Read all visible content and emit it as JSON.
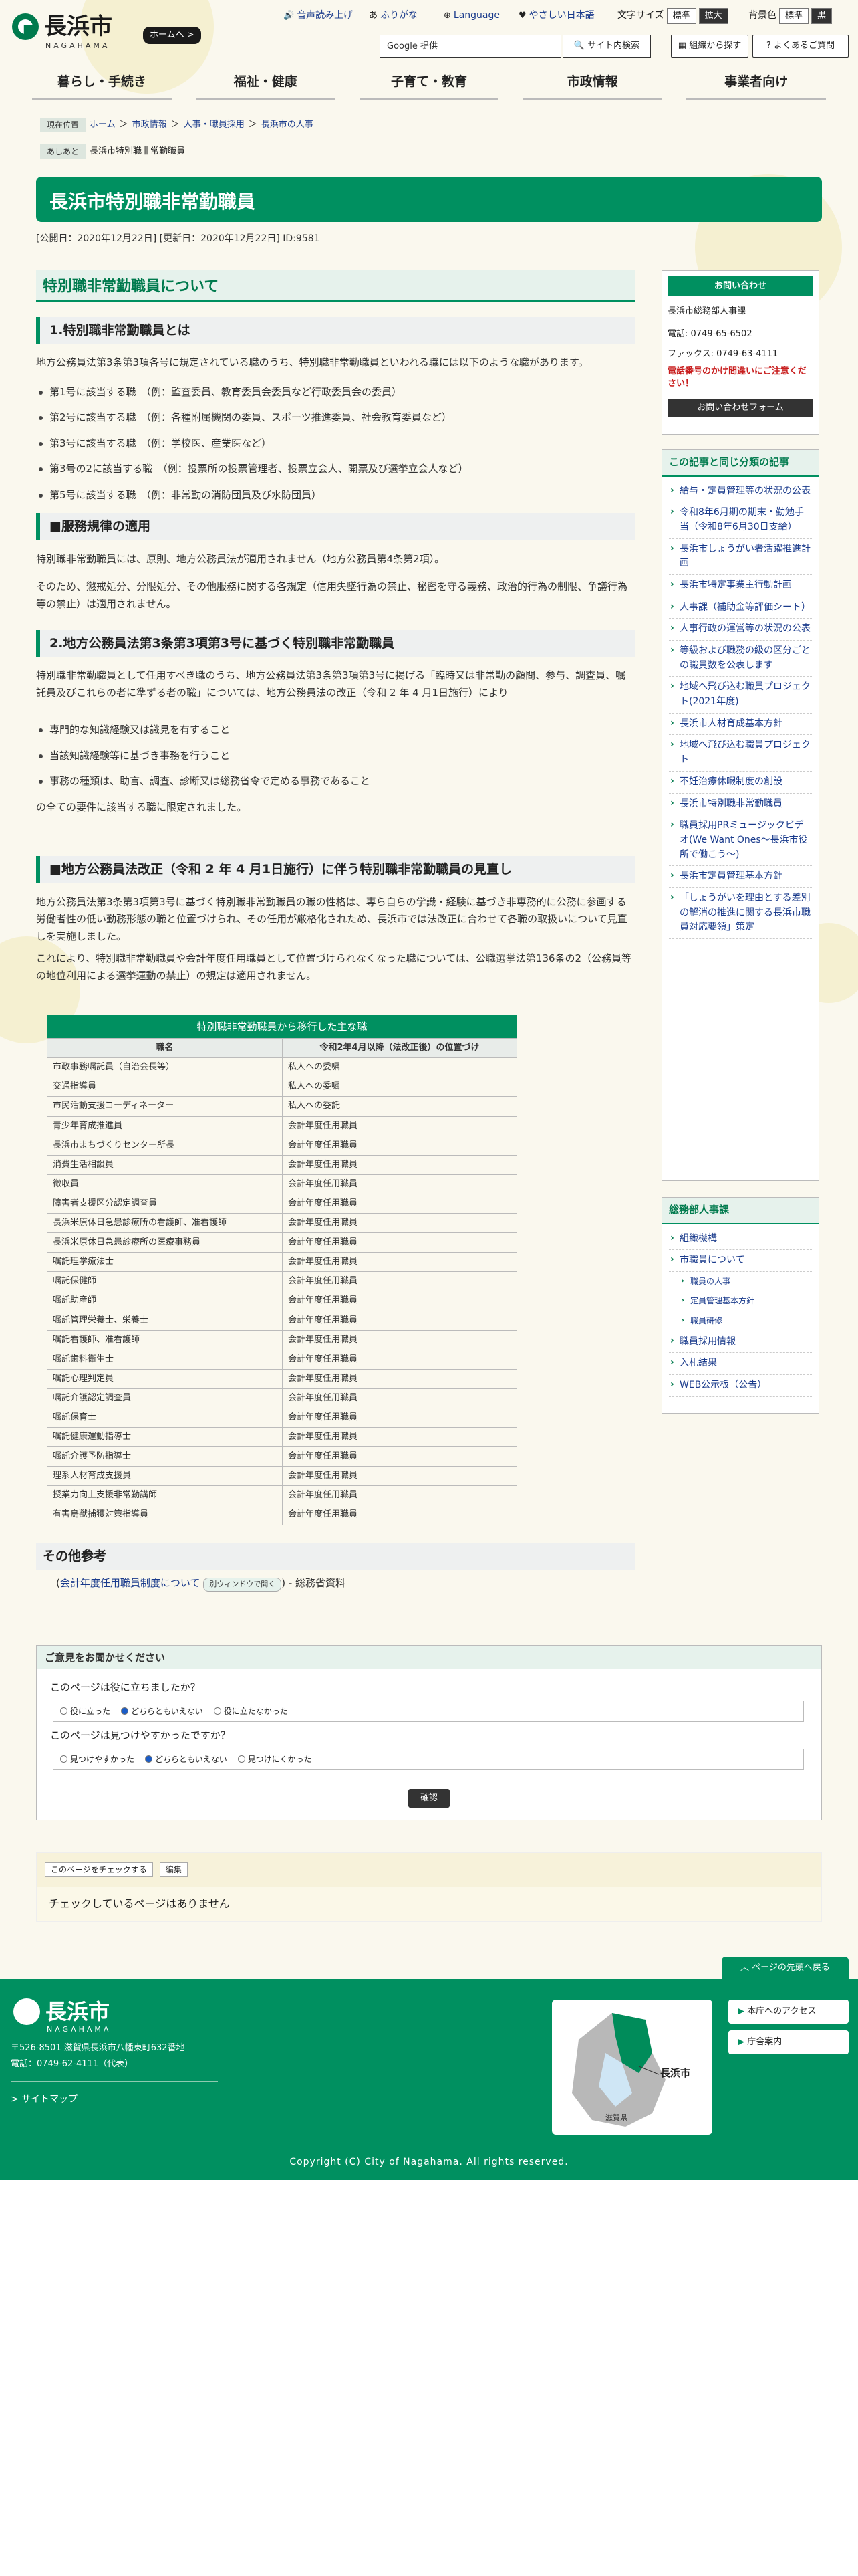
{
  "header": {
    "logo_text": "長浜市",
    "logo_sub": "NAGAHAMA",
    "home_button": "ホームへ >",
    "voice": "音声読み上げ",
    "furigana": "ふりがな",
    "language": "Language",
    "easy_japanese": "やさしい日本語",
    "font_size_label": "文字サイズ",
    "font_standard": "標準",
    "font_large": "拡大",
    "bg_color_label": "背景色",
    "bg_standard": "標準",
    "bg_black": "黒",
    "search_placeholder": "Google 提供",
    "search_button": "サイト内検索",
    "org_button": "組織から探す",
    "faq_button": "よくあるご質問"
  },
  "global_nav": [
    "暮らし・手続き",
    "福祉・健康",
    "子育て・教育",
    "市政情報",
    "事業者向け"
  ],
  "breadcrumb": {
    "label": "現在位置",
    "items": [
      "ホーム",
      "市政情報",
      "人事・職員採用",
      "長浜市の人事"
    ]
  },
  "attention": {
    "label": "あしあと",
    "text": "長浜市特別職非常勤職員"
  },
  "page_title": "長浜市特別職非常勤職員",
  "dates": {
    "published": "[公開日：2020年12月22日]",
    "updated": "[更新日：2020年12月22日]",
    "id": "ID:9581"
  },
  "main": {
    "h2": "特別職非常勤職員について",
    "s1_title": "1.特別職非常勤職員とは",
    "s1_text": "地方公務員法第3条第3項各号に規定されている職のうち、特別職非常勤職員といわれる職には以下のような職があります。",
    "s1_list": [
      "第1号に該当する職　（例：監査委員、教育委員会委員など行政委員会の委員）",
      "第2号に該当する職　（例：各種附属機関の委員、スポーツ推進委員、社会教育委員など）",
      "第3号に該当する職　（例：学校医、産業医など）",
      "第3号の2に該当する職　（例：投票所の投票管理者、投票立会人、開票及び選挙立会人など）",
      "第5号に該当する職　（例：非常勤の消防団員及び水防団員）"
    ],
    "rule_title": "■服務規律の適用",
    "rule_p1": "特別職非常勤職員には、原則、地方公務員法が適用されません（地方公務員第4条第2項）。",
    "rule_p2": "そのため、懲戒処分、分限処分、その他服務に関する各規定（信用失墜行為の禁止、秘密を守る義務、政治的行為の制限、争議行為等の禁止）は適用されません。",
    "s2_title": "2.地方公務員法第3条第3項第3号に基づく特別職非常勤職員",
    "s2_text": "特別職非常勤職員として任用すべき職のうち、地方公務員法第3条第3項第3号に掲げる「臨時又は非常勤の顧問、参与、調査員、嘱託員及びこれらの者に準ずる者の職」については、地方公務員法の改正（令和 2 年 4 月1日施行）により",
    "s2_list": [
      "専門的な知識経験又は識見を有すること",
      "当該知識経験等に基づき事務を行うこと",
      "事務の種類は、助言、調査、診断又は総務省令で定める事務であること"
    ],
    "s2_after": "の全ての要件に該当する職に限定されました。",
    "s3_title": "■地方公務員法改正（令和 2 年 4 月1日施行）に伴う特別職非常勤職員の見直し",
    "s3_p1": "地方公務員法第3条第3項第3号に基づく特別職非常勤職員の職の性格は、専ら自らの学識・経験に基づき非専務的に公務に参画する労働者性の低い勤務形態の職と位置づけられ、その任用が厳格化されため、長浜市では法改正に合わせて各職の取扱いについて見直しを実施しました。",
    "s3_p2": "これにより、特別職非常勤職員や会計年度任用職員として位置づけられなくなった職については、公職選挙法第136条の2（公務員等の地位利用による選挙運動の禁止）の規定は適用されません。",
    "table_caption": "特別職非常勤職員から移行した主な職",
    "table_headers": [
      "職名",
      "令和2年4月以降（法改正後）の位置づけ"
    ],
    "table_rows": [
      [
        "市政事務嘱託員（自治会長等）",
        "私人への委嘱"
      ],
      [
        "交通指導員",
        "私人への委嘱"
      ],
      [
        "市民活動支援コーディネーター",
        "私人への委託"
      ],
      [
        "青少年育成推進員",
        "会計年度任用職員"
      ],
      [
        "長浜市まちづくりセンター所長",
        "会計年度任用職員"
      ],
      [
        "消費生活相談員",
        "会計年度任用職員"
      ],
      [
        "徴収員",
        "会計年度任用職員"
      ],
      [
        "障害者支援区分認定調査員",
        "会計年度任用職員"
      ],
      [
        "長浜米原休日急患診療所の看護師、准看護師",
        "会計年度任用職員"
      ],
      [
        "長浜米原休日急患診療所の医療事務員",
        "会計年度任用職員"
      ],
      [
        "嘱託理学療法士",
        "会計年度任用職員"
      ],
      [
        "嘱託保健師",
        "会計年度任用職員"
      ],
      [
        "嘱託助産師",
        "会計年度任用職員"
      ],
      [
        "嘱託管理栄養士、栄養士",
        "会計年度任用職員"
      ],
      [
        "嘱託看護師、准看護師",
        "会計年度任用職員"
      ],
      [
        "嘱託歯科衛生士",
        "会計年度任用職員"
      ],
      [
        "嘱託心理判定員",
        "会計年度任用職員"
      ],
      [
        "嘱託介護認定調査員",
        "会計年度任用職員"
      ],
      [
        "嘱託保育士",
        "会計年度任用職員"
      ],
      [
        "嘱託健康運動指導士",
        "会計年度任用職員"
      ],
      [
        "嘱託介護予防指導士",
        "会計年度任用職員"
      ],
      [
        "理系人材育成支援員",
        "会計年度任用職員"
      ],
      [
        "授業力向上支援非常勤講師",
        "会計年度任用職員"
      ],
      [
        "有害鳥獣捕獲対策指導員",
        "会計年度任用職員"
      ]
    ],
    "ref_title": "その他参考",
    "ref_link": "会計年度任用職員制度について",
    "ref_badge": "別ウィンドウで開く",
    "ref_suffix": "- 総務省資料"
  },
  "sidebar": {
    "contact_title": "お問い合わせ",
    "dept": "長浜市総務部人事課",
    "tel": "電話: 0749-65-6502",
    "fax": "ファックス: 0749-63-4111",
    "warning": "電話番号のかけ間違いにご注意ください！",
    "form_button": "お問い合わせフォーム",
    "related_title": "この記事と同じ分類の記事",
    "related": [
      "給与・定員管理等の状況の公表",
      "令和8年6月期の期末・勤勉手当（令和8年6月30日支給）",
      "長浜市しょうがい者活躍推進計画",
      "長浜市特定事業主行動計画",
      "人事課（補助金等評価シート）",
      "人事行政の運営等の状況の公表",
      "等級および職務の級の区分ごとの職員数を公表します",
      "地域へ飛び込む職員プロジェクト(2021年度)",
      "長浜市人材育成基本方針",
      "地域へ飛び込む職員プロジェクト",
      "不妊治療休暇制度の創設",
      "長浜市特別職非常勤職員",
      "職員採用PRミュージックビデオ(We Want Ones〜長浜市役所で働こう〜)",
      "長浜市定員管理基本方針",
      "「しょうがいを理由とする差別の解消の推進に関する長浜市職員対応要領」策定"
    ],
    "dept_title": "総務部人事課",
    "dept_links": [
      "組織機構",
      "市職員について",
      "職員の人事",
      "定員管理基本方針",
      "職員研修",
      "職員採用情報",
      "入札結果",
      "WEB公示板（公告）"
    ]
  },
  "feedback": {
    "title": "ご意見をお聞かせください",
    "q1": "このページは役に立ちましたか？",
    "q1_options": [
      "役に立った",
      "どちらともいえない",
      "役に立たなかった"
    ],
    "q2": "このページは見つけやすかったですか？",
    "q2_options": [
      "見つけやすかった",
      "どちらともいえない",
      "見つけにくかった"
    ],
    "submit": "確認"
  },
  "check": {
    "chip1": "このページをチェックする",
    "chip2": "編集",
    "text": "チェックしているページはありません"
  },
  "footer": {
    "back_to_top": "ページの先頭へ戻る",
    "logo_text": "長浜市",
    "logo_sub": "NAGAHAMA",
    "address": "〒526-8501 滋賀県長浜市八幡東町632番地",
    "phone": "電話：0749-62-4111（代表）",
    "sitemap": "> サイトマップ",
    "map_label_city": "長浜市",
    "map_label_pref": "滋賀県",
    "access": "本庁へのアクセス",
    "guide": "庁舎案内",
    "copyright": "Copyright (C) City of Nagahama. All rights reserved."
  },
  "colors": {
    "brand_green": "#009060",
    "accent_red": "#c81e1e",
    "link_blue": "#1a3b8c"
  }
}
